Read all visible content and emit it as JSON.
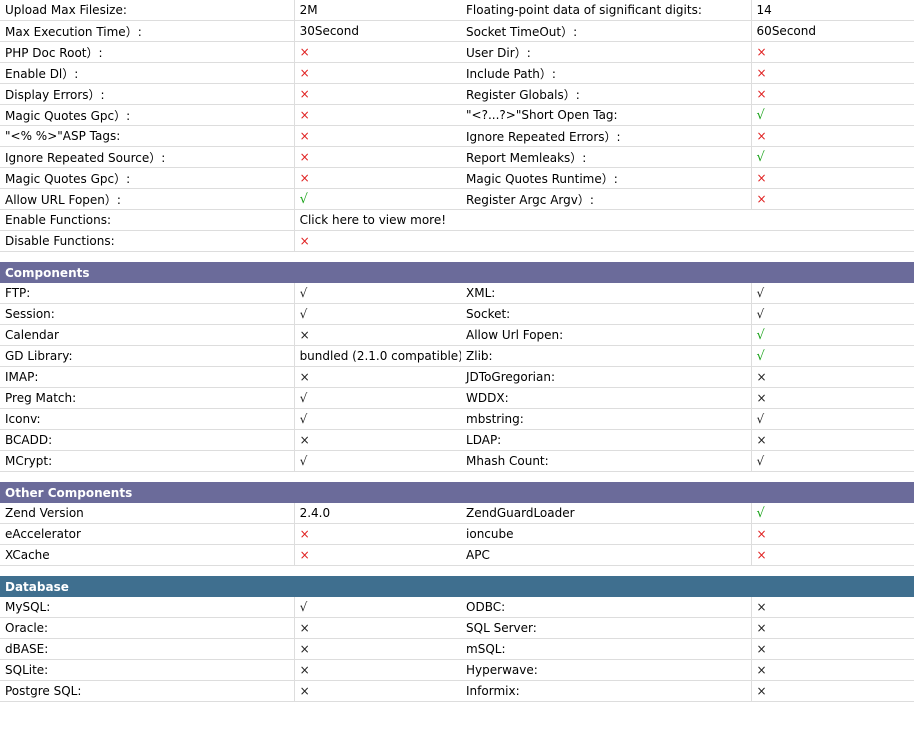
{
  "colors": {
    "header_purple": "#6b6b9a",
    "header_teal": "#3f6f8f",
    "mark_red": "#e02020",
    "mark_green": "#1aa31a"
  },
  "icons": {
    "check": "check-icon",
    "cross": "cross-icon"
  },
  "settings": {
    "rows": [
      {
        "l1": "Upload Max Filesize:",
        "v1": "2M",
        "l2": "Floating-point data of significant digits:",
        "v2": "14"
      },
      {
        "l1": "Max Execution Time）:",
        "v1": "30Second",
        "l2": "Socket TimeOut）:",
        "v2": "60Second"
      },
      {
        "l1": "PHP Doc Root）:",
        "v1": "×",
        "l2": "User Dir）:",
        "v2": "×"
      },
      {
        "l1": "Enable Dl）:",
        "v1": "×",
        "l2": "Include Path）:",
        "v2": "×"
      },
      {
        "l1": "Display Errors）:",
        "v1": "×",
        "l2": "Register Globals）:",
        "v2": "×"
      },
      {
        "l1": "Magic Quotes Gpc）:",
        "v1": "×",
        "l2": "\"<?...?>\"Short Open Tag:",
        "v2": "√"
      },
      {
        "l1": "\"<% %>\"ASP Tags:",
        "v1": "×",
        "l2": "Ignore Repeated Errors）:",
        "v2": "×"
      },
      {
        "l1": "Ignore Repeated Source）:",
        "v1": "×",
        "l2": "Report Memleaks）:",
        "v2": "√"
      },
      {
        "l1": "Magic Quotes Gpc）:",
        "v1": "×",
        "l2": "Magic Quotes Runtime）:",
        "v2": "×"
      },
      {
        "l1": "Allow URL Fopen）:",
        "v1": "√",
        "l2": "Register Argc Argv）:",
        "v2": "×"
      }
    ],
    "enable_functions_label": "Enable Functions:",
    "enable_functions_link": "Click here to view more!",
    "disable_functions_label": "Disable Functions:",
    "disable_functions_value": "×"
  },
  "components": {
    "title": "Components",
    "rows": [
      {
        "l1": "FTP:",
        "v1": "√",
        "l2": "XML:",
        "v2": "√"
      },
      {
        "l1": "Session:",
        "v1": "√",
        "l2": "Socket:",
        "v2": "√"
      },
      {
        "l1": "Calendar",
        "v1": "×",
        "l2": "Allow Url Fopen:",
        "v2": "√"
      },
      {
        "l1": "GD Library:",
        "v1": "bundled (2.1.0 compatible)",
        "l2": "Zlib:",
        "v2": "√"
      },
      {
        "l1": "IMAP:",
        "v1": "×",
        "l2": "JDToGregorian:",
        "v2": "×"
      },
      {
        "l1": "Preg Match:",
        "v1": "√",
        "l2": "WDDX:",
        "v2": "×"
      },
      {
        "l1": "Iconv:",
        "v1": "√",
        "l2": "mbstring:",
        "v2": "√"
      },
      {
        "l1": "BCADD:",
        "v1": "×",
        "l2": "LDAP:",
        "v2": "×"
      },
      {
        "l1": "MCrypt:",
        "v1": "√",
        "l2": "Mhash Count:",
        "v2": "√"
      }
    ]
  },
  "other_components": {
    "title": "Other Components",
    "rows": [
      {
        "l1": "Zend Version",
        "v1": "2.4.0",
        "l2": "ZendGuardLoader",
        "v2": "√"
      },
      {
        "l1": "eAccelerator",
        "v1": "×",
        "l2": "ioncube",
        "v2": "×"
      },
      {
        "l1": "XCache",
        "v1": "×",
        "l2": "APC",
        "v2": "×"
      }
    ]
  },
  "database": {
    "title": "Database",
    "rows": [
      {
        "l1": "MySQL:",
        "v1": "√",
        "l2": "ODBC:",
        "v2": "×"
      },
      {
        "l1": "Oracle:",
        "v1": "×",
        "l2": "SQL Server:",
        "v2": "×"
      },
      {
        "l1": "dBASE:",
        "v1": "×",
        "l2": "mSQL:",
        "v2": "×"
      },
      {
        "l1": "SQLite:",
        "v1": "×",
        "l2": "Hyperwave:",
        "v2": "×"
      },
      {
        "l1": "Postgre SQL:",
        "v1": "×",
        "l2": "Informix:",
        "v2": "×"
      }
    ]
  }
}
